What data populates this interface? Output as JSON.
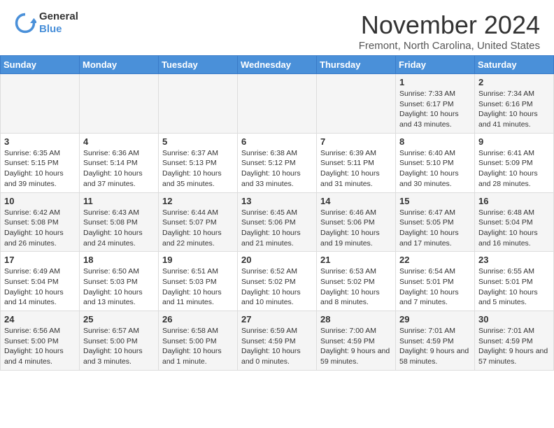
{
  "header": {
    "logo": {
      "line1": "General",
      "line2": "Blue"
    },
    "title": "November 2024",
    "location": "Fremont, North Carolina, United States"
  },
  "weekdays": [
    "Sunday",
    "Monday",
    "Tuesday",
    "Wednesday",
    "Thursday",
    "Friday",
    "Saturday"
  ],
  "weeks": [
    [
      {
        "day": "",
        "info": ""
      },
      {
        "day": "",
        "info": ""
      },
      {
        "day": "",
        "info": ""
      },
      {
        "day": "",
        "info": ""
      },
      {
        "day": "",
        "info": ""
      },
      {
        "day": "1",
        "info": "Sunrise: 7:33 AM\nSunset: 6:17 PM\nDaylight: 10 hours and 43 minutes."
      },
      {
        "day": "2",
        "info": "Sunrise: 7:34 AM\nSunset: 6:16 PM\nDaylight: 10 hours and 41 minutes."
      }
    ],
    [
      {
        "day": "3",
        "info": "Sunrise: 6:35 AM\nSunset: 5:15 PM\nDaylight: 10 hours and 39 minutes."
      },
      {
        "day": "4",
        "info": "Sunrise: 6:36 AM\nSunset: 5:14 PM\nDaylight: 10 hours and 37 minutes."
      },
      {
        "day": "5",
        "info": "Sunrise: 6:37 AM\nSunset: 5:13 PM\nDaylight: 10 hours and 35 minutes."
      },
      {
        "day": "6",
        "info": "Sunrise: 6:38 AM\nSunset: 5:12 PM\nDaylight: 10 hours and 33 minutes."
      },
      {
        "day": "7",
        "info": "Sunrise: 6:39 AM\nSunset: 5:11 PM\nDaylight: 10 hours and 31 minutes."
      },
      {
        "day": "8",
        "info": "Sunrise: 6:40 AM\nSunset: 5:10 PM\nDaylight: 10 hours and 30 minutes."
      },
      {
        "day": "9",
        "info": "Sunrise: 6:41 AM\nSunset: 5:09 PM\nDaylight: 10 hours and 28 minutes."
      }
    ],
    [
      {
        "day": "10",
        "info": "Sunrise: 6:42 AM\nSunset: 5:08 PM\nDaylight: 10 hours and 26 minutes."
      },
      {
        "day": "11",
        "info": "Sunrise: 6:43 AM\nSunset: 5:08 PM\nDaylight: 10 hours and 24 minutes."
      },
      {
        "day": "12",
        "info": "Sunrise: 6:44 AM\nSunset: 5:07 PM\nDaylight: 10 hours and 22 minutes."
      },
      {
        "day": "13",
        "info": "Sunrise: 6:45 AM\nSunset: 5:06 PM\nDaylight: 10 hours and 21 minutes."
      },
      {
        "day": "14",
        "info": "Sunrise: 6:46 AM\nSunset: 5:06 PM\nDaylight: 10 hours and 19 minutes."
      },
      {
        "day": "15",
        "info": "Sunrise: 6:47 AM\nSunset: 5:05 PM\nDaylight: 10 hours and 17 minutes."
      },
      {
        "day": "16",
        "info": "Sunrise: 6:48 AM\nSunset: 5:04 PM\nDaylight: 10 hours and 16 minutes."
      }
    ],
    [
      {
        "day": "17",
        "info": "Sunrise: 6:49 AM\nSunset: 5:04 PM\nDaylight: 10 hours and 14 minutes."
      },
      {
        "day": "18",
        "info": "Sunrise: 6:50 AM\nSunset: 5:03 PM\nDaylight: 10 hours and 13 minutes."
      },
      {
        "day": "19",
        "info": "Sunrise: 6:51 AM\nSunset: 5:03 PM\nDaylight: 10 hours and 11 minutes."
      },
      {
        "day": "20",
        "info": "Sunrise: 6:52 AM\nSunset: 5:02 PM\nDaylight: 10 hours and 10 minutes."
      },
      {
        "day": "21",
        "info": "Sunrise: 6:53 AM\nSunset: 5:02 PM\nDaylight: 10 hours and 8 minutes."
      },
      {
        "day": "22",
        "info": "Sunrise: 6:54 AM\nSunset: 5:01 PM\nDaylight: 10 hours and 7 minutes."
      },
      {
        "day": "23",
        "info": "Sunrise: 6:55 AM\nSunset: 5:01 PM\nDaylight: 10 hours and 5 minutes."
      }
    ],
    [
      {
        "day": "24",
        "info": "Sunrise: 6:56 AM\nSunset: 5:00 PM\nDaylight: 10 hours and 4 minutes."
      },
      {
        "day": "25",
        "info": "Sunrise: 6:57 AM\nSunset: 5:00 PM\nDaylight: 10 hours and 3 minutes."
      },
      {
        "day": "26",
        "info": "Sunrise: 6:58 AM\nSunset: 5:00 PM\nDaylight: 10 hours and 1 minute."
      },
      {
        "day": "27",
        "info": "Sunrise: 6:59 AM\nSunset: 4:59 PM\nDaylight: 10 hours and 0 minutes."
      },
      {
        "day": "28",
        "info": "Sunrise: 7:00 AM\nSunset: 4:59 PM\nDaylight: 9 hours and 59 minutes."
      },
      {
        "day": "29",
        "info": "Sunrise: 7:01 AM\nSunset: 4:59 PM\nDaylight: 9 hours and 58 minutes."
      },
      {
        "day": "30",
        "info": "Sunrise: 7:01 AM\nSunset: 4:59 PM\nDaylight: 9 hours and 57 minutes."
      }
    ]
  ]
}
